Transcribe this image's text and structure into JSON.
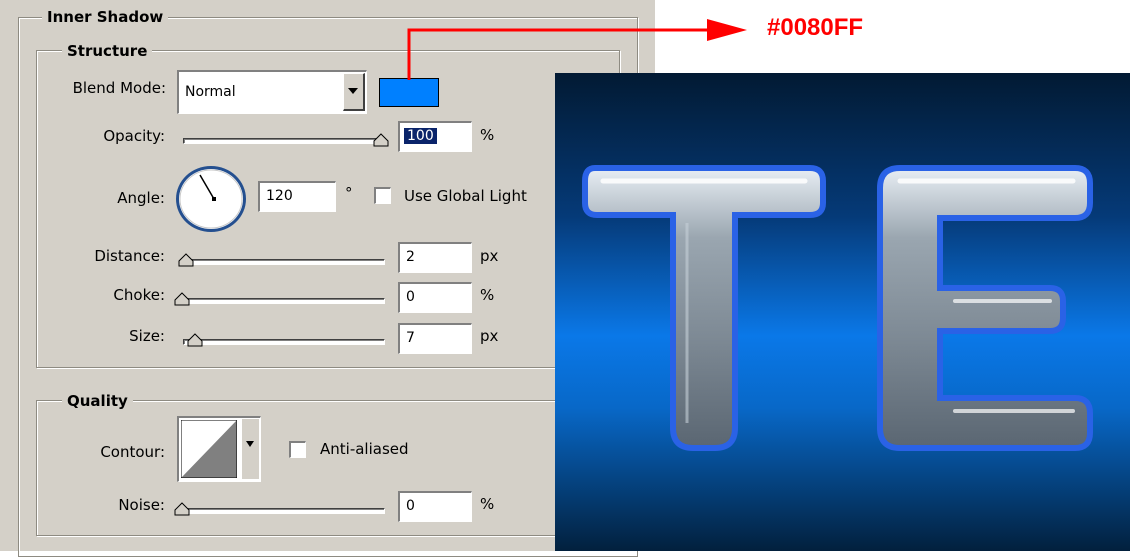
{
  "annotation": {
    "color_label": "#0080FF",
    "arrow_color": "#ff0000"
  },
  "inner_shadow": {
    "title": "Inner Shadow",
    "structure": {
      "title": "Structure",
      "blend_mode_label": "Blend Mode:",
      "blend_mode_value": "Normal",
      "color_swatch": "#0080ff",
      "opacity_label": "Opacity:",
      "opacity_value": "100",
      "opacity_unit": "%",
      "opacity_slider_fraction": 1.0,
      "angle_label": "Angle:",
      "angle_value": "120",
      "angle_unit": "°",
      "use_global_light_label": "Use Global Light",
      "use_global_light_checked": false,
      "distance_label": "Distance:",
      "distance_value": "2",
      "distance_unit": "px",
      "choke_label": "Choke:",
      "choke_value": "0",
      "choke_unit": "%",
      "size_label": "Size:",
      "size_value": "7",
      "size_unit": "px"
    },
    "quality": {
      "title": "Quality",
      "contour_label": "Contour:",
      "anti_aliased_label": "Anti-aliased",
      "anti_aliased_checked": false,
      "noise_label": "Noise:",
      "noise_value": "0",
      "noise_unit": "%"
    }
  },
  "preview": {
    "text": "TE",
    "background_top": "#021a33",
    "background_mid": "#0a78e8",
    "background_bottom": "#02203d",
    "letter_color": "#9aa4ad"
  }
}
